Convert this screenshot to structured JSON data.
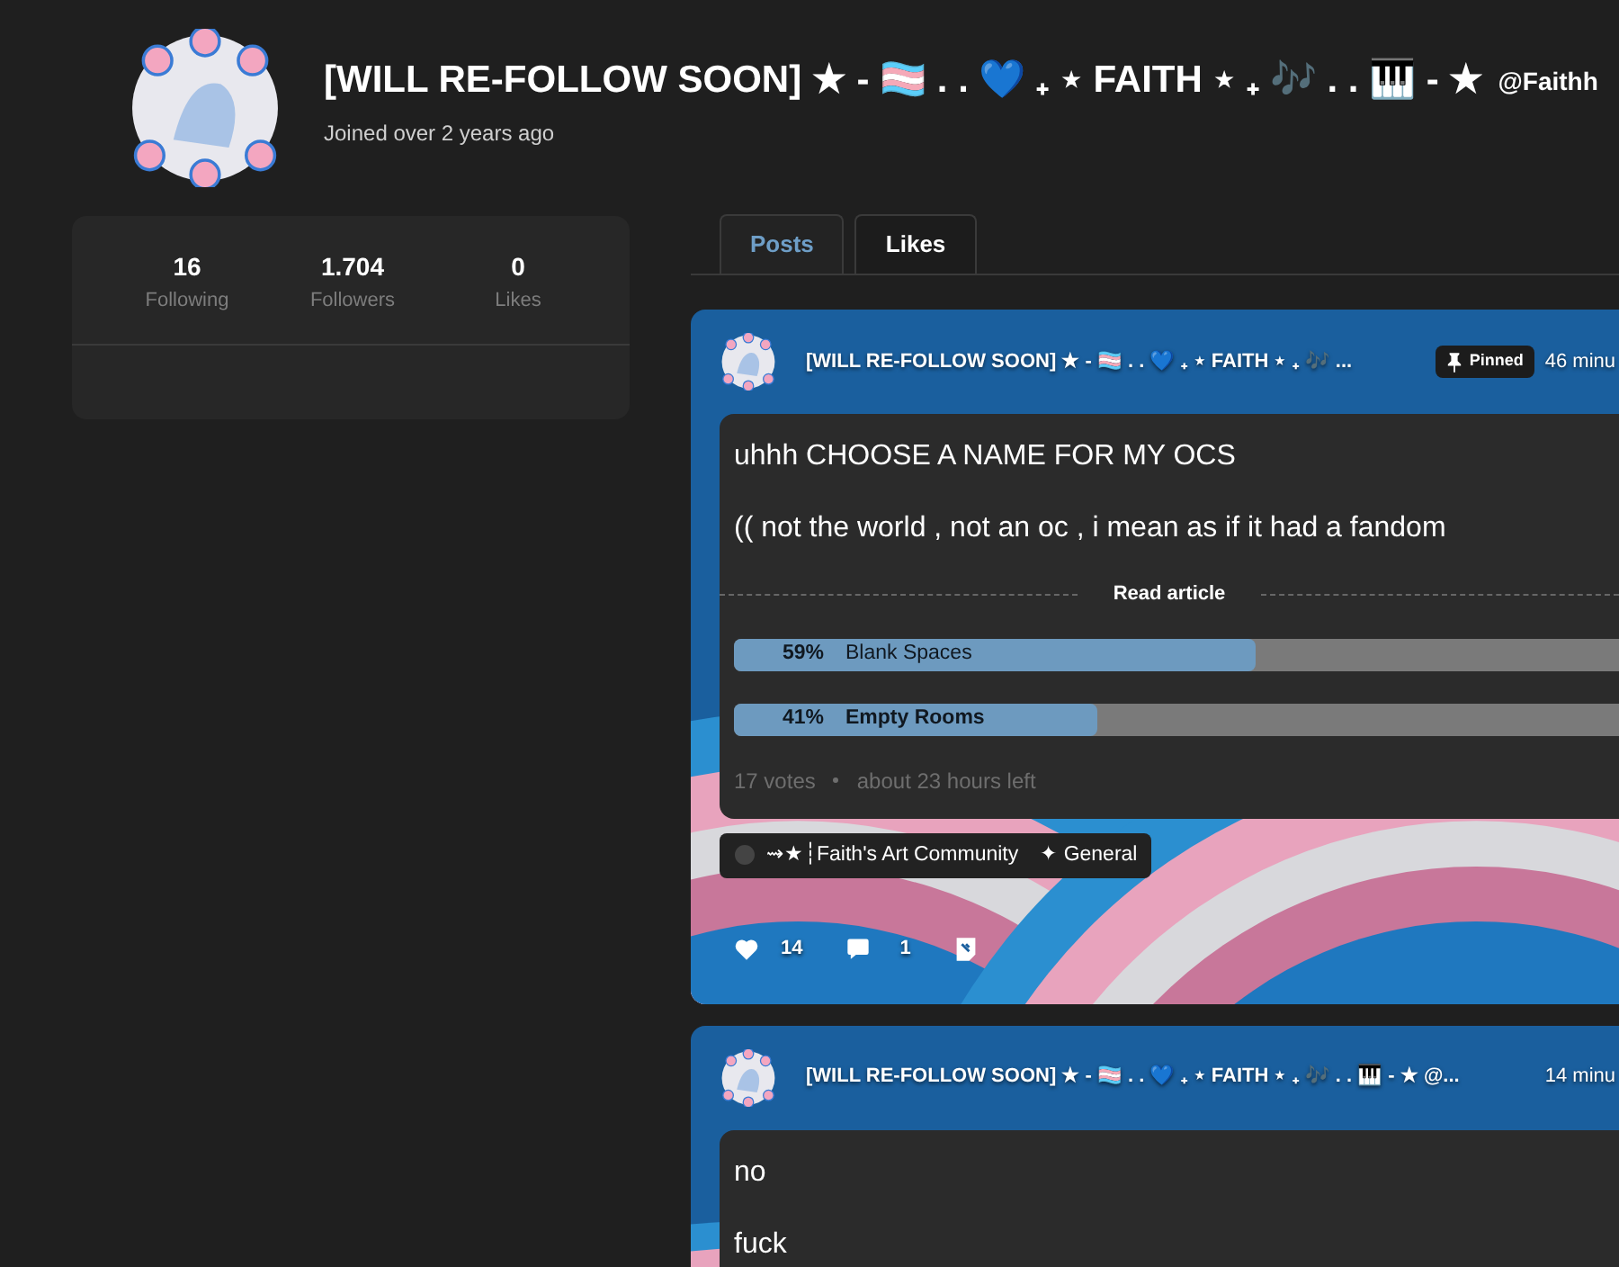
{
  "profile": {
    "name": "[WILL RE-FOLLOW SOON] ★ - 🏳️‍⚧️ . . 💙 ₊ ⋆ FAITH ⋆ ₊ 🎶 . . 🎹 - ★",
    "handle": "@Faithh",
    "joined": "Joined over 2 years ago"
  },
  "stats": [
    {
      "value": "16",
      "label": "Following"
    },
    {
      "value": "1.704",
      "label": "Followers"
    },
    {
      "value": "0",
      "label": "Likes"
    }
  ],
  "tabs": [
    {
      "label": "Posts",
      "selected": true
    },
    {
      "label": "Likes",
      "selected": false
    }
  ],
  "posts": [
    {
      "author": "[WILL RE-FOLLOW SOON] ★ - 🏳️‍⚧️ . . 💙 ₊ ⋆ FAITH ⋆ ₊ 🎶 ...",
      "pinned_label": "Pinned",
      "time": "46 minu",
      "title": "uhhh CHOOSE A NAME FOR MY OCS",
      "body": [
        "(( not the world , not an oc , i mean as if it had a fandom"
      ],
      "read_more": "Read article",
      "poll": {
        "options": [
          {
            "percent": "59%",
            "label": "Blank Spaces",
            "level": 0.59,
            "selected": false
          },
          {
            "percent": "41%",
            "label": "Empty Rooms",
            "level": 0.41,
            "selected": true
          }
        ],
        "votes": "17 votes",
        "time_left": "about 23 hours left"
      },
      "community": "⇝★┆Faith's Art Community",
      "channel": "✦ General",
      "likes": "14",
      "comments": "1"
    },
    {
      "author": "[WILL RE-FOLLOW SOON] ★ - 🏳️‍⚧️ . . 💙 ₊ ⋆ FAITH ⋆ ₊ 🎶 . . 🎹 - ★ @...",
      "time": "14 minu",
      "body": [
        "no",
        "fuck"
      ]
    }
  ]
}
